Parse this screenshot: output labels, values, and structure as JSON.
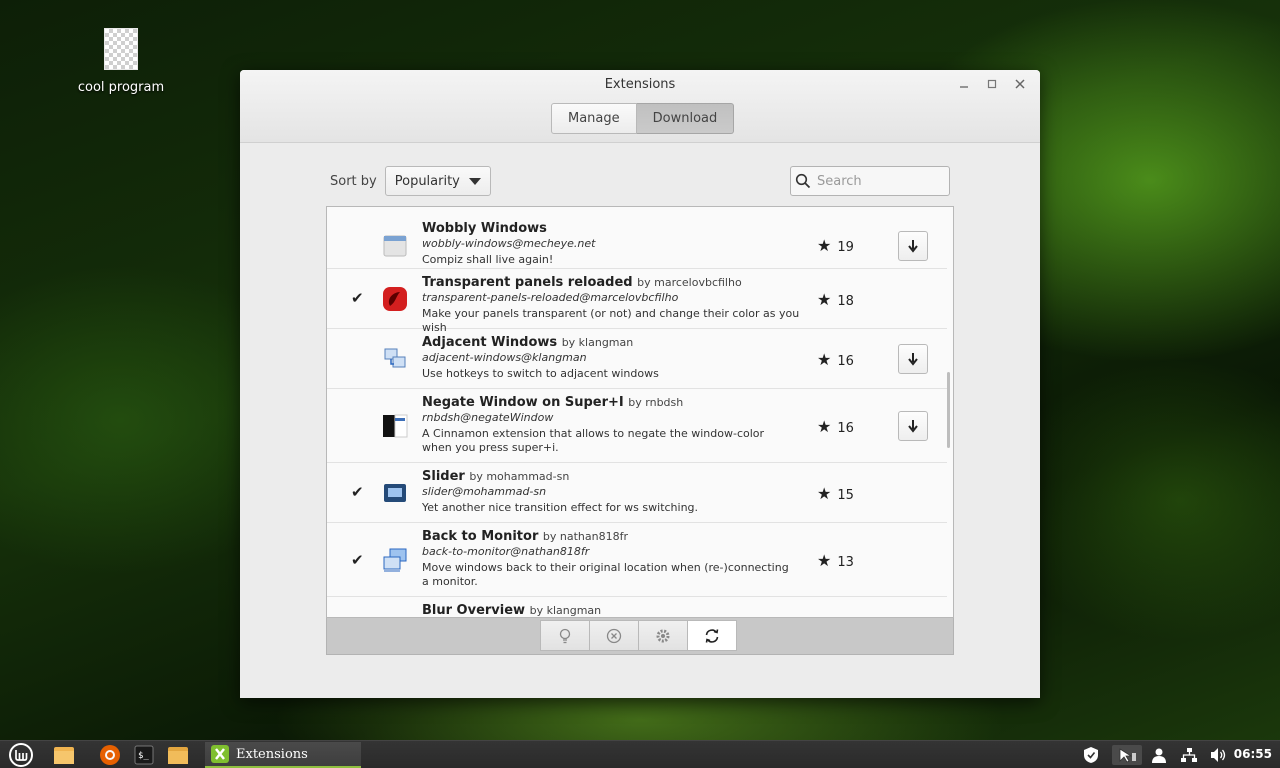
{
  "desktop": {
    "icon_label": "cool program"
  },
  "window": {
    "title": "Extensions",
    "tabs": [
      {
        "label": "Manage"
      },
      {
        "label": "Download"
      }
    ]
  },
  "controls": {
    "sort_label": "Sort by",
    "sort_value": "Popularity",
    "search_placeholder": "Search"
  },
  "extensions": [
    {
      "name": "Wobbly Windows",
      "author": "",
      "uuid": "wobbly-windows@mecheye.net",
      "description": "Compiz shall live again!",
      "score": "19",
      "installed": false
    },
    {
      "name": "Transparent panels reloaded",
      "author": "by marcelovbcfilho",
      "uuid": "transparent-panels-reloaded@marcelovbcfilho",
      "description": "Make your panels transparent (or not) and change their color as you wish",
      "score": "18",
      "installed": true
    },
    {
      "name": "Adjacent Windows",
      "author": "by klangman",
      "uuid": "adjacent-windows@klangman",
      "description": "Use hotkeys to switch to adjacent windows",
      "score": "16",
      "installed": false
    },
    {
      "name": "Negate Window on Super+I",
      "author": "by rnbdsh",
      "uuid": "rnbdsh@negateWindow",
      "description": "A Cinnamon extension that allows to negate the window-color when you press super+i.",
      "score": "16",
      "installed": false
    },
    {
      "name": "Slider",
      "author": "by mohammad-sn",
      "uuid": "slider@mohammad-sn",
      "description": "Yet another nice transition effect for ws switching.",
      "score": "15",
      "installed": true
    },
    {
      "name": "Back to Monitor",
      "author": "by nathan818fr",
      "uuid": "back-to-monitor@nathan818fr",
      "description": "Move windows back to their original location when (re-)connecting a monitor.",
      "score": "13",
      "installed": true
    },
    {
      "name": "Blur Overview",
      "author": "by klangman",
      "uuid": "",
      "description": "",
      "score": "",
      "installed": false
    }
  ],
  "taskbar": {
    "active_task": "Extensions",
    "clock": "06:55"
  },
  "colors": {
    "accent": "#8fbf3f",
    "wallpaper": "#16310a"
  }
}
